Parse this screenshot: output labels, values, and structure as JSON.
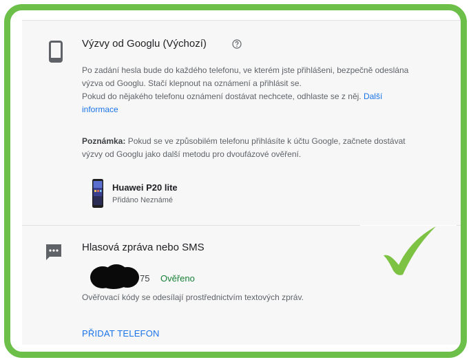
{
  "colors": {
    "frame": "#6cc04a",
    "link": "#1a73e8",
    "verified": "#188038",
    "check": "#7dc243"
  },
  "google_prompt": {
    "icon": "smartphone-icon",
    "title": "Výzvy od Googlu (Výchozí)",
    "help_icon": "help-circle-icon",
    "line1": "Po zadání hesla bude do každého telefonu, ve kterém jste přihlášeni, bezpečně odeslána",
    "line2": "výzva od Googlu. Stačí klepnout na oznámení a přihlásit se.",
    "line3": "Pokud do nějakého telefonu oznámení dostávat nechcete, odhlaste se z něj.",
    "link1": "Další",
    "link2": "informace",
    "note_label": "Poznámka:",
    "note_line1": "Pokud se ve způsobilém telefonu přihlásíte k účtu Google, začnete dostávat",
    "note_line2": "výzvy od Googlu jako další metodu pro dvoufázové ověření.",
    "device_name": "Huawei P20 lite",
    "device_added": "Přidáno Neznámé"
  },
  "sms": {
    "icon": "message-icon",
    "title": "Hlasová zpráva nebo SMS",
    "phone_suffix": "75",
    "verified": "Ověřeno",
    "description": "Ověřovací kódy se odesílají prostřednictvím textových zpráv.",
    "add_phone": "PŘIDAT TELEFON"
  },
  "overlay": {
    "check_icon": "checkmark-icon"
  }
}
